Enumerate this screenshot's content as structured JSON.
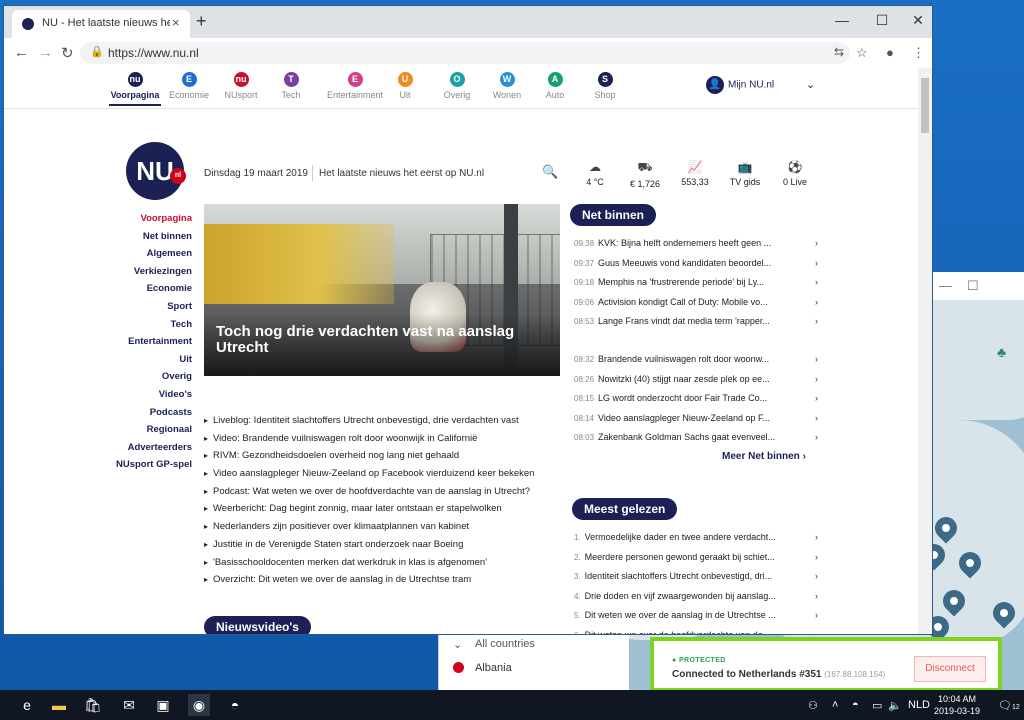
{
  "browser": {
    "tab_title": "NU - Het laatste nieuws het eerst",
    "tab_close": "×",
    "new_tab": "+",
    "url": "https://www.nu.nl"
  },
  "nav": [
    {
      "label": "Voorpagina",
      "letter": "nu",
      "color": "#1b2154",
      "active": true
    },
    {
      "label": "Economie",
      "letter": "E",
      "color": "#1f6fd1"
    },
    {
      "label": "NUsport",
      "letter": "nu",
      "color": "#c8102e"
    },
    {
      "label": "Tech",
      "letter": "T",
      "color": "#7b3fa0"
    },
    {
      "label": "Entertainment",
      "letter": "E",
      "color": "#d43f8d"
    },
    {
      "label": "Uit",
      "letter": "U",
      "color": "#f08c1a"
    },
    {
      "label": "Overig",
      "letter": "O",
      "color": "#16a3a3"
    },
    {
      "label": "Wonen",
      "letter": "W",
      "color": "#2d8fd5"
    },
    {
      "label": "Auto",
      "letter": "A",
      "color": "#17a06b"
    },
    {
      "label": "Shop",
      "letter": "S",
      "color": "#1b2154"
    }
  ],
  "mijn_nu": "Mijn NU.nl",
  "header": {
    "logo": "NU",
    "logo_suffix": "nl",
    "date": "Dinsdag 19 maart 2019",
    "tagline": "Het laatste nieuws het eerst op NU.nl"
  },
  "widgets": [
    {
      "icon": "☁",
      "name": "weather-widget",
      "label": "4 °C"
    },
    {
      "icon": "⛟",
      "name": "fuel-widget",
      "label": "€ 1,726"
    },
    {
      "icon": "📈",
      "name": "aex-widget",
      "label": "553,33"
    },
    {
      "icon": "📺",
      "name": "tvgids-widget",
      "label": "TV gids"
    },
    {
      "icon": "⚽",
      "name": "live-widget",
      "label": "0 Live"
    }
  ],
  "sidebar": [
    "Voorpagina",
    "Net binnen",
    "Algemeen",
    "Verkiezingen",
    "Economie",
    "Sport",
    "Tech",
    "Entertainment",
    "Uit",
    "Overig",
    "Video's",
    "Podcasts",
    "Regionaal",
    "Adverteerders",
    "NUsport GP-spel"
  ],
  "hero_headline": "Toch nog drie verdachten vast na aanslag Utrecht",
  "bullets": [
    "Liveblog: Identiteit slachtoffers Utrecht onbevestigd, drie verdachten vast",
    "Video: Brandende vuilniswagen rolt door woonwijk in Californië",
    "RIVM: Gezondheidsdoelen overheid nog lang niet gehaald",
    "Video aanslagpleger Nieuw-Zeeland op Facebook vierduizend keer bekeken",
    "Podcast: Wat weten we over de hoofdverdachte van de aanslag in Utrecht?",
    "Weerbericht: Dag begint zonnig, maar later ontstaan er stapelwolken",
    "Nederlanders zijn positiever over klimaatplannen van kabinet",
    "Justitie in de Verenigde Staten start onderzoek naar Boeing",
    "'Basisschooldocenten merken dat werkdruk in klas is afgenomen'",
    "Overzicht: Dit weten we over de aanslag in de Utrechtse tram"
  ],
  "nieuwsvideos": "Nieuwsvideo's",
  "net_binnen": {
    "title": "Net binnen",
    "group1": [
      {
        "time": "09:38",
        "text": "KVK: Bijna helft ondernemers heeft geen ..."
      },
      {
        "time": "09:37",
        "text": "Guus Meeuwis vond kandidaten beoordel..."
      },
      {
        "time": "09:18",
        "text": "Memphis na 'frustrerende periode' bij Ly..."
      },
      {
        "time": "09:06",
        "text": "Activision kondigt Call of Duty: Mobile vo..."
      },
      {
        "time": "08:53",
        "text": "Lange Frans vindt dat media term 'rapper..."
      }
    ],
    "group2": [
      {
        "time": "08:32",
        "text": "Brandende vuilniswagen rolt door woonw..."
      },
      {
        "time": "08:26",
        "text": "Nowitzki (40) stijgt naar zesde plek op ee..."
      },
      {
        "time": "08:15",
        "text": "LG wordt onderzocht door Fair Trade Co..."
      },
      {
        "time": "08:14",
        "text": "Video aanslagpleger Nieuw-Zeeland op F..."
      },
      {
        "time": "08:03",
        "text": "Zakenbank Goldman Sachs gaat evenveel..."
      }
    ],
    "more": "Meer Net binnen"
  },
  "meest_gelezen": {
    "title": "Meest gelezen",
    "items": [
      {
        "n": "1.",
        "text": "Vermoedelijke dader en twee andere verdacht..."
      },
      {
        "n": "2.",
        "text": "Meerdere personen gewond geraakt bij schiet..."
      },
      {
        "n": "3.",
        "text": "Identiteit slachtoffers Utrecht onbevestigd, dri..."
      },
      {
        "n": "4.",
        "text": "Drie doden en vijf zwaargewonden bij aanslag..."
      },
      {
        "n": "5.",
        "text": "Dit weten we over de aanslag in de Utrechtse ..."
      },
      {
        "n": "6.",
        "text": "Dit weten we over de hoofdverdachte van de ..."
      }
    ]
  },
  "vpn": {
    "all_countries": "All countries",
    "country": "Albania",
    "status": "PROTECTED",
    "connected": "Connected to Netherlands #351",
    "ip": "(167.88.108.154)",
    "disconnect": "Disconnect"
  },
  "taskbar": {
    "lang": "NLD",
    "time": "10:04 AM",
    "date": "2019-03-19",
    "notif_count": "12"
  }
}
